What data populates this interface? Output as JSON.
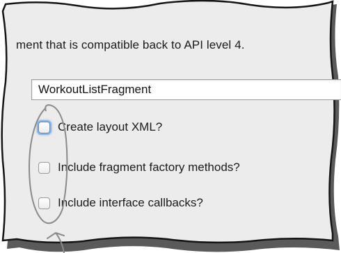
{
  "dialog": {
    "description": "ment that is compatible back to API level 4.",
    "fragment_name": "WorkoutListFragment",
    "options": [
      {
        "label": "Create layout XML?",
        "checked": false,
        "focused": true
      },
      {
        "label": "Include fragment factory methods?",
        "checked": false,
        "focused": false
      },
      {
        "label": "Include interface callbacks?",
        "checked": false,
        "focused": false
      }
    ]
  }
}
